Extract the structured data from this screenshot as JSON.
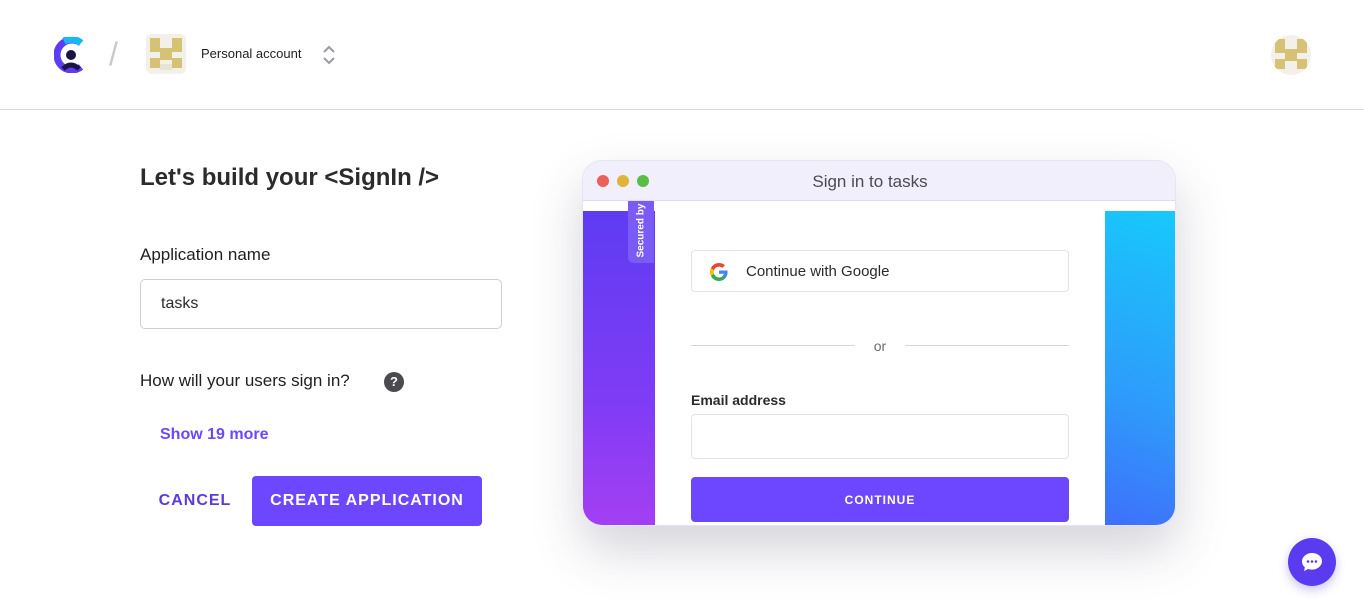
{
  "header": {
    "account_name": "Personal account",
    "separator": "/"
  },
  "form": {
    "title": "Let's build your <SignIn />",
    "app_name_label": "Application name",
    "app_name_value": "tasks",
    "signin_question": "How will your users sign in?",
    "help_glyph": "?",
    "show_more": "Show 19 more",
    "cancel_label": "CANCEL",
    "create_label": "CREATE APPLICATION"
  },
  "preview": {
    "window_title": "Sign in to tasks",
    "secured_badge": "Secured by",
    "google_label": "Continue with Google",
    "divider_text": "or",
    "email_label": "Email address",
    "continue_label": "CONTINUE"
  },
  "colors": {
    "accent": "#6c47ff",
    "gradient_left": "#5e3cf2",
    "gradient_right": "#17c9fb"
  },
  "icons": [
    "clerk-logo-icon",
    "chevron-updown-icon",
    "help-icon",
    "google-icon",
    "chat-icon"
  ]
}
